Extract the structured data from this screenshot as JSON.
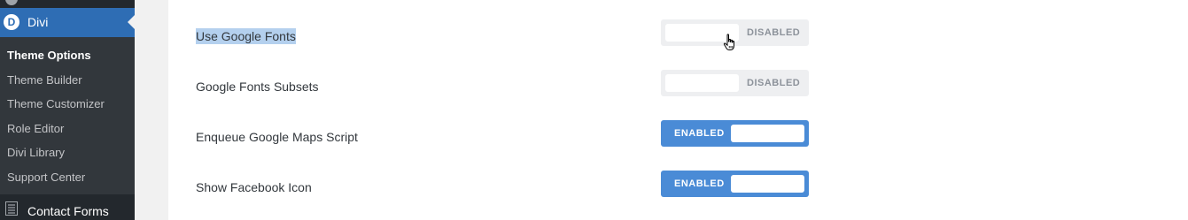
{
  "sidebar": {
    "main_item": {
      "label": "Divi",
      "logo_letter": "D",
      "icon": "divi-logo-icon"
    },
    "submenu": [
      {
        "label": "Theme Options",
        "current": true
      },
      {
        "label": "Theme Builder"
      },
      {
        "label": "Theme Customizer"
      },
      {
        "label": "Role Editor"
      },
      {
        "label": "Divi Library"
      },
      {
        "label": "Support Center"
      }
    ],
    "next_item": {
      "label": "Contact Forms",
      "icon": "contact-forms-icon"
    }
  },
  "settings": [
    {
      "label": "Use Google Fonts",
      "state": "DISABLED",
      "enabled": false,
      "selected": true
    },
    {
      "label": "Google Fonts Subsets",
      "state": "DISABLED",
      "enabled": false
    },
    {
      "label": "Enqueue Google Maps Script",
      "state": "ENABLED",
      "enabled": true
    },
    {
      "label": "Show Facebook Icon",
      "state": "ENABLED",
      "enabled": true
    }
  ],
  "colors": {
    "sidebar_bg": "#23282d",
    "submenu_bg": "#32373c",
    "active_menu": "#2e6db4",
    "toggle_enabled": "#4a8bd6",
    "toggle_disabled": "#eeeff1",
    "text_selection": "#b4d0ee"
  },
  "cursor": "hand-pointer-icon"
}
